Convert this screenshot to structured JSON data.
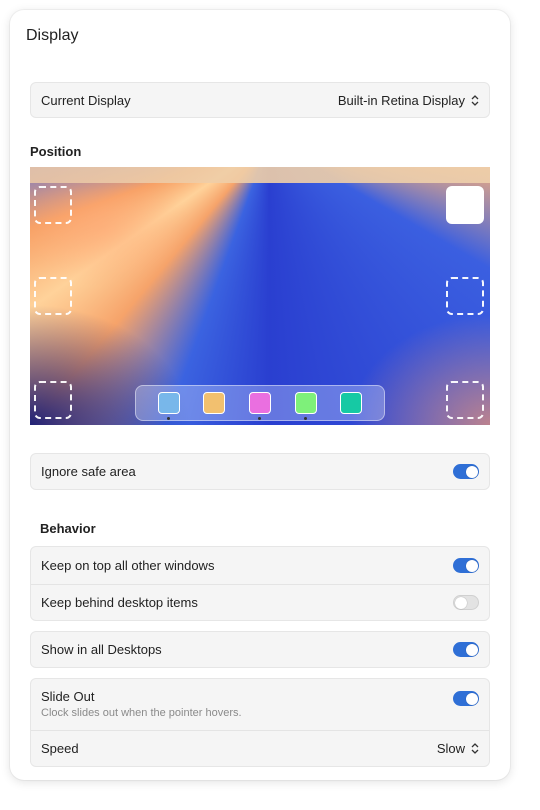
{
  "window": {
    "title": "Display"
  },
  "current_display": {
    "label": "Current Display",
    "value": "Built-in Retina Display"
  },
  "position": {
    "label": "Position",
    "selected_slot": "top-right",
    "dock_apps": [
      {
        "color": "#78b7ea",
        "running": true
      },
      {
        "color": "#f2c06f",
        "running": false
      },
      {
        "color": "#ea6fe0",
        "running": true
      },
      {
        "color": "#7ef07a",
        "running": true
      },
      {
        "color": "#16c9a4",
        "running": false
      }
    ]
  },
  "safe_area": {
    "label": "Ignore safe area",
    "enabled": true
  },
  "behavior": {
    "label": "Behavior",
    "keep_on_top": {
      "label": "Keep on top all other windows",
      "enabled": true
    },
    "keep_behind": {
      "label": "Keep behind desktop items",
      "enabled": false
    },
    "show_all_desktops": {
      "label": "Show in all Desktops",
      "enabled": true
    },
    "slide_out": {
      "label": "Slide Out",
      "description": "Clock slides out when the pointer hovers.",
      "enabled": true
    },
    "speed": {
      "label": "Speed",
      "value": "Slow"
    }
  },
  "colors": {
    "accent": "#2f6fd6"
  }
}
